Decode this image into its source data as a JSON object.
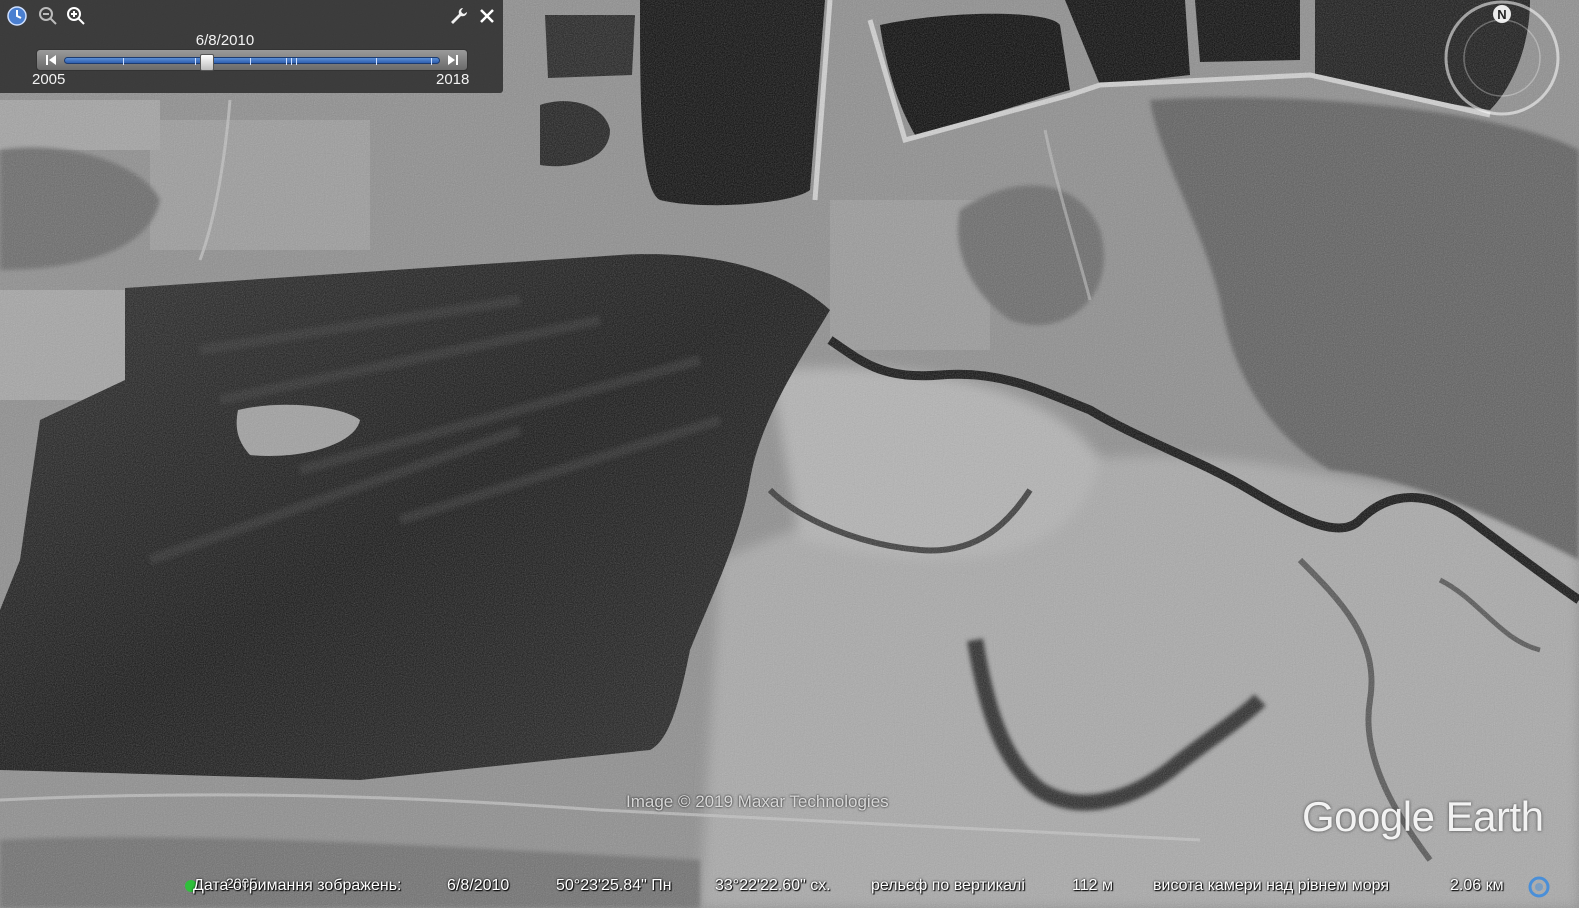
{
  "app": {
    "copyright": "Image © 2019 Maxar Technologies",
    "brand": "Google Earth"
  },
  "time_slider": {
    "selected_date": "6/8/2010",
    "start_year": "2005",
    "end_year": "2018",
    "position_fraction": 0.38,
    "icons": {
      "clock": "clock-icon",
      "zoom_out": "zoom-out-icon",
      "zoom_in": "zoom-in-icon",
      "settings": "wrench-icon",
      "close": "close-icon",
      "previous": "skip-back-icon",
      "next": "skip-forward-icon"
    }
  },
  "compass": {
    "north_label": "N"
  },
  "status_bar": {
    "overlay_year": "2005",
    "date_label": "Дата отримання зображень:",
    "date_value": "6/8/2010",
    "latitude": "50°23'25.84\" Пн",
    "longitude": "33°22'22.60\" сх.",
    "elevation_label": "рельєф по вертикалі",
    "elevation_value": "112 м",
    "camera_label": "висота камери над рівнем моря",
    "camera_value": "2.06 км"
  },
  "colors": {
    "panel_bg": "#282828",
    "slider_blue": "#3d6fc4",
    "status_dot": "#2fbf3a",
    "streaming_ring": "#4a8fd8"
  }
}
